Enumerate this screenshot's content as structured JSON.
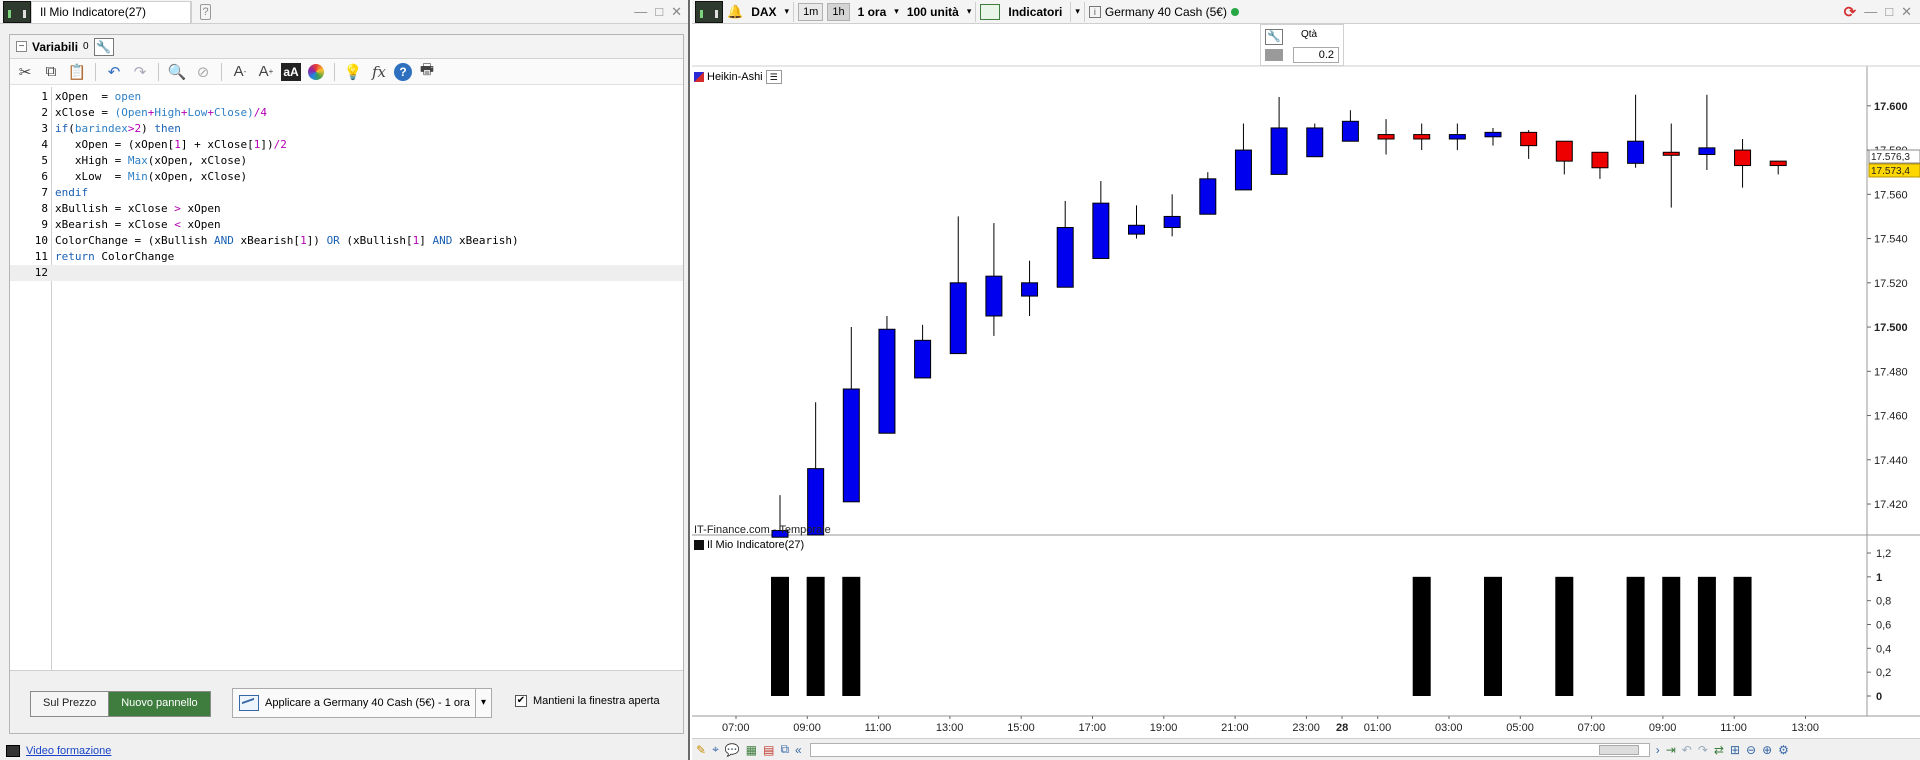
{
  "left_window": {
    "tab_title": "Il Mio Indicatore(27)",
    "variables_label": "Variabili",
    "variables_count": "0",
    "toolbar_icons": [
      "scissors-icon",
      "copy-icon",
      "paste-icon",
      "undo-icon",
      "redo-icon",
      "search-icon",
      "comment-icon",
      "font-decrease-icon",
      "font-increase-icon",
      "text-style-icon",
      "color-wheel-icon",
      "lightbulb-icon",
      "function-icon",
      "help-icon",
      "print-icon"
    ],
    "code_lines": [
      {
        "n": "1",
        "parts": [
          [
            "pl",
            "xOpen  = "
          ],
          [
            "fn",
            "open"
          ]
        ]
      },
      {
        "n": "2",
        "parts": [
          [
            "pl",
            "xClose = "
          ],
          [
            "fn",
            "("
          ],
          [
            "fn",
            "Open"
          ],
          [
            "num",
            "+"
          ],
          [
            "fn",
            "High"
          ],
          [
            "num",
            "+"
          ],
          [
            "fn",
            "Low"
          ],
          [
            "num",
            "+"
          ],
          [
            "fn",
            "Close"
          ],
          [
            "fn",
            ")"
          ],
          [
            "num",
            "/4"
          ]
        ]
      },
      {
        "n": "3",
        "parts": [
          [
            "kw",
            "if"
          ],
          [
            "pl",
            "("
          ],
          [
            "fn",
            "barindex"
          ],
          [
            "num",
            ">2"
          ],
          [
            "pl",
            ") "
          ],
          [
            "kw",
            "then"
          ]
        ]
      },
      {
        "n": "4",
        "parts": [
          [
            "pl",
            "   xOpen = (xOpen["
          ],
          [
            "num",
            "1"
          ],
          [
            "pl",
            "] + xClose["
          ],
          [
            "num",
            "1"
          ],
          [
            "pl",
            "])"
          ],
          [
            "num",
            "/2"
          ]
        ]
      },
      {
        "n": "5",
        "parts": [
          [
            "pl",
            "   xHigh = "
          ],
          [
            "fn",
            "Max"
          ],
          [
            "pl",
            "(xOpen, xClose)"
          ]
        ]
      },
      {
        "n": "6",
        "parts": [
          [
            "pl",
            "   xLow  = "
          ],
          [
            "fn",
            "Min"
          ],
          [
            "pl",
            "(xOpen, xClose)"
          ]
        ]
      },
      {
        "n": "7",
        "parts": [
          [
            "kw",
            "endif"
          ]
        ]
      },
      {
        "n": "8",
        "parts": [
          [
            "pl",
            "xBullish = xClose "
          ],
          [
            "num",
            ">"
          ],
          [
            "pl",
            " xOpen"
          ]
        ]
      },
      {
        "n": "9",
        "parts": [
          [
            "pl",
            "xBearish = xClose "
          ],
          [
            "num",
            "<"
          ],
          [
            "pl",
            " xOpen"
          ]
        ]
      },
      {
        "n": "10",
        "parts": [
          [
            "pl",
            "ColorChange = (xBullish "
          ],
          [
            "kw",
            "AND"
          ],
          [
            "pl",
            " xBearish["
          ],
          [
            "num",
            "1"
          ],
          [
            "pl",
            "]) "
          ],
          [
            "kw",
            "OR"
          ],
          [
            "pl",
            " (xBullish["
          ],
          [
            "num",
            "1"
          ],
          [
            "pl",
            "] "
          ],
          [
            "kw",
            "AND"
          ],
          [
            "pl",
            " xBearish)"
          ]
        ]
      },
      {
        "n": "11",
        "parts": [
          [
            "kw",
            "return"
          ],
          [
            "pl",
            " ColorChange"
          ]
        ]
      },
      {
        "n": "12",
        "parts": []
      }
    ],
    "btn_price": "Sul Prezzo",
    "btn_new_panel": "Nuovo pannello",
    "apply_label": "Applicare a Germany 40 Cash (5€) - 1 ora",
    "keep_open_label": "Mantieni la finestra aperta",
    "keep_open_checked": true,
    "status_link": "Video formazione"
  },
  "chart_window": {
    "symbol": "DAX",
    "tf_1m": "1m",
    "tf_1h": "1h",
    "period": "1 ora",
    "units": "100 unità",
    "indicators_label": "Indicatori",
    "instrument": "Germany 40 Cash (5€)",
    "qty_label": "Qtà",
    "qty_value": "0.2",
    "price_panel_label": "Heikin-Ashi",
    "indicator_panel_label": "Il Mio Indicatore(27)",
    "watermark": "IT-Finance.com - Temporale",
    "price_tag_1": "17.576,3",
    "price_tag_2": "17.573,4",
    "colors": {
      "bull": "#0000ee",
      "bear": "#ee0000",
      "bar": "#000000",
      "price_tag": "#ffd700"
    }
  },
  "chart_data": [
    {
      "type": "candlestick",
      "title": "Heikin-Ashi",
      "x_ticks": [
        "07:00",
        "09:00",
        "11:00",
        "13:00",
        "15:00",
        "17:00",
        "19:00",
        "21:00",
        "23:00",
        "28",
        "01:00",
        "03:00",
        "05:00",
        "07:00",
        "09:00",
        "11:00",
        "13:00"
      ],
      "y_ticks": [
        "17.600",
        "17.580",
        "17.560",
        "17.540",
        "17.520",
        "17.500",
        "17.480",
        "17.460",
        "17.440",
        "17.420"
      ],
      "ylim": [
        17406,
        17618
      ],
      "candles": [
        {
          "o": 17405,
          "c": 17408,
          "h": 17424,
          "l": 17405
        },
        {
          "o": 17406,
          "c": 17436,
          "h": 17466,
          "l": 17406
        },
        {
          "o": 17421,
          "c": 17472,
          "h": 17500,
          "l": 17421
        },
        {
          "o": 17452,
          "c": 17499,
          "h": 17505,
          "l": 17452
        },
        {
          "o": 17477,
          "c": 17494,
          "h": 17501,
          "l": 17477
        },
        {
          "o": 17488,
          "c": 17520,
          "h": 17550,
          "l": 17488
        },
        {
          "o": 17505,
          "c": 17523,
          "h": 17547,
          "l": 17496
        },
        {
          "o": 17514,
          "c": 17520,
          "h": 17530,
          "l": 17505
        },
        {
          "o": 17518,
          "c": 17545,
          "h": 17557,
          "l": 17518
        },
        {
          "o": 17531,
          "c": 17556,
          "h": 17566,
          "l": 17531
        },
        {
          "o": 17542,
          "c": 17546,
          "h": 17555,
          "l": 17540
        },
        {
          "o": 17545,
          "c": 17550,
          "h": 17560,
          "l": 17541
        },
        {
          "o": 17551,
          "c": 17567,
          "h": 17570,
          "l": 17551
        },
        {
          "o": 17562,
          "c": 17580,
          "h": 17592,
          "l": 17562
        },
        {
          "o": 17569,
          "c": 17590,
          "h": 17604,
          "l": 17569
        },
        {
          "o": 17577,
          "c": 17590,
          "h": 17592,
          "l": 17577
        },
        {
          "o": 17584,
          "c": 17593,
          "h": 17598,
          "l": 17584
        },
        {
          "o": 17587,
          "c": 17585,
          "h": 17594,
          "l": 17578
        },
        {
          "o": 17587,
          "c": 17585,
          "h": 17592,
          "l": 17580
        },
        {
          "o": 17585,
          "c": 17587,
          "h": 17592,
          "l": 17580
        },
        {
          "o": 17586,
          "c": 17588,
          "h": 17590,
          "l": 17582
        },
        {
          "o": 17588,
          "c": 17582,
          "h": 17589,
          "l": 17576
        },
        {
          "o": 17584,
          "c": 17575,
          "h": 17584,
          "l": 17569
        },
        {
          "o": 17579,
          "c": 17572,
          "h": 17579,
          "l": 17567
        },
        {
          "o": 17574,
          "c": 17584,
          "h": 17605,
          "l": 17572
        },
        {
          "o": 17579,
          "c": 17578,
          "h": 17592,
          "l": 17554
        },
        {
          "o": 17578,
          "c": 17581,
          "h": 17605,
          "l": 17571
        },
        {
          "o": 17580,
          "c": 17573,
          "h": 17585,
          "l": 17563
        },
        {
          "o": 17575,
          "c": 17573,
          "h": 17575,
          "l": 17569
        }
      ]
    },
    {
      "type": "bar",
      "title": "Il Mio Indicatore(27)",
      "y_ticks": [
        "1,2",
        "1",
        "0,8",
        "0,6",
        "0,4",
        "0,2",
        "0"
      ],
      "ylim": [
        0,
        1.2
      ],
      "values": [
        1,
        1,
        1,
        0,
        0,
        0,
        0,
        0,
        0,
        0,
        0,
        0,
        0,
        0,
        0,
        0,
        0,
        0,
        1,
        0,
        1,
        0,
        1,
        0,
        1,
        1,
        1,
        1,
        0
      ]
    }
  ]
}
